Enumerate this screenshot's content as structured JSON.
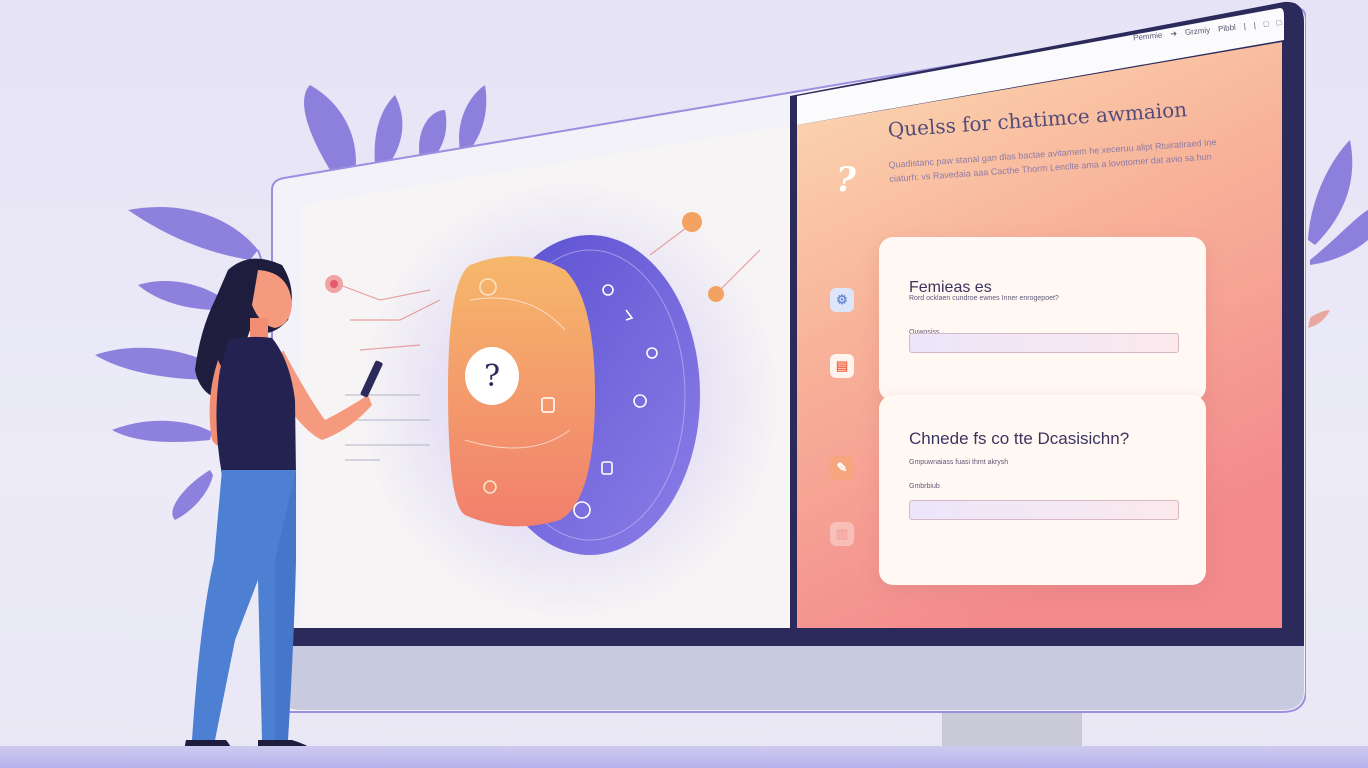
{
  "top_bar": {
    "items": [
      "Pemmie",
      "➔",
      "Grzmiy",
      "Pibbl",
      "|",
      "|",
      "□",
      "□"
    ]
  },
  "panel": {
    "question_mark": "?",
    "title": "Quelss for chatimce awmaion",
    "subtitle": "Quadistanc paw stanal gan dlas bactae avitamem he xeceruu alipt Rtuiratiraed Ine ciaturh: vs Ravedaia aaa Cacthe Thorm Lenclte ama a lovotomer dat avio sa hun"
  },
  "card1": {
    "heading": "Femieas es",
    "description": "Rord ocklaen cundroe ewnes Inner enrogepoet?",
    "label": "Quwosiss",
    "input_value": ""
  },
  "card2": {
    "heading": "Chnede fs co tte Dcasisichn?",
    "description": "Gmpuwnaiass fuasi thmt akrysh",
    "label": "Gmbrbiub",
    "input_value": ""
  },
  "diagram": {
    "center_label": "?"
  },
  "colors": {
    "navy": "#2c2a5a",
    "accent_orange": "#f4a262",
    "accent_purple": "#6b5fd6",
    "panel_gradient_start": "#fbd3b0",
    "panel_gradient_end": "#f48f8f"
  },
  "icons": [
    "leaf-icon",
    "gear-icon",
    "document-icon",
    "pen-icon",
    "question-icon"
  ]
}
